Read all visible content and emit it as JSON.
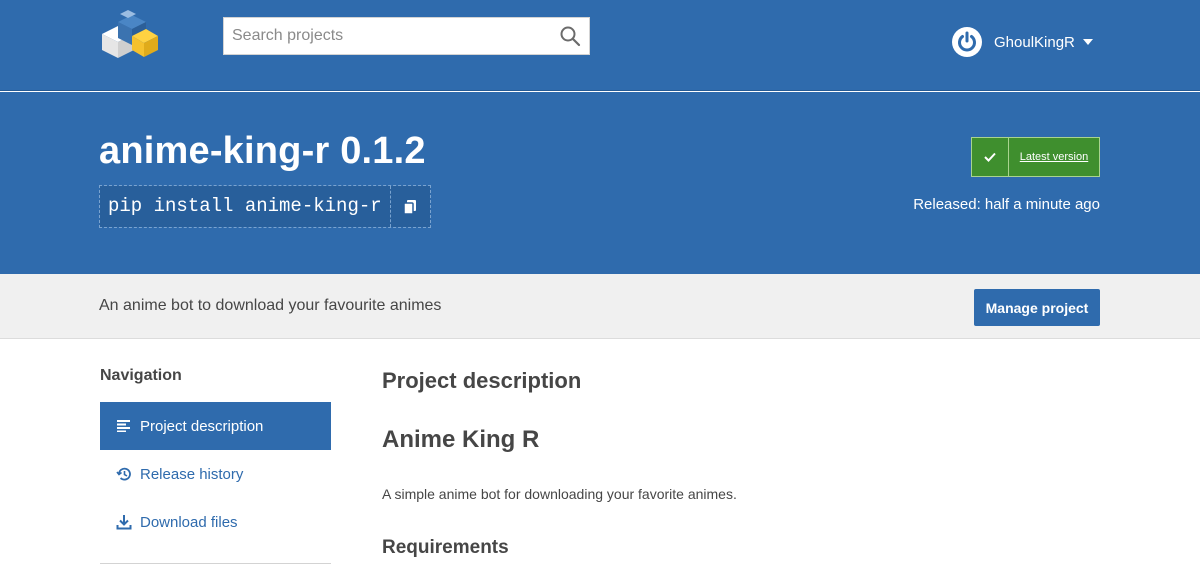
{
  "header": {
    "search_placeholder": "Search projects",
    "username": "GhoulKingR"
  },
  "hero": {
    "title": "anime-king-r 0.1.2",
    "pip_command": "pip install anime-king-r",
    "latest_label": "Latest version",
    "released": "Released: half a minute ago"
  },
  "summary": {
    "text": "An anime bot to download your favourite animes",
    "manage_label": "Manage project"
  },
  "sidebar": {
    "heading": "Navigation",
    "items": [
      {
        "label": "Project description",
        "icon": "align-left-icon",
        "active": true
      },
      {
        "label": "Release history",
        "icon": "history-icon",
        "active": false
      },
      {
        "label": "Download files",
        "icon": "download-icon",
        "active": false
      }
    ]
  },
  "main": {
    "section_title": "Project description",
    "readme_title": "Anime King R",
    "readme_text": "A simple anime bot for downloading your favorite animes.",
    "requirements_title": "Requirements"
  },
  "colors": {
    "brand_blue": "#2f6bad",
    "latest_green": "#3f8f2e",
    "summary_bg": "#f0f0f0"
  }
}
